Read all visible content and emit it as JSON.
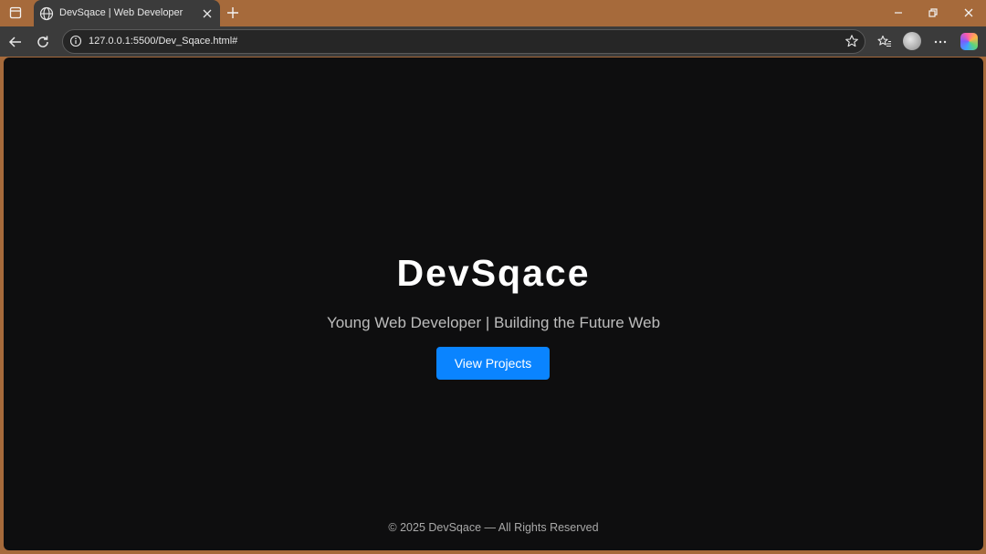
{
  "browser": {
    "tab_title": "DevSqace | Web Developer",
    "url": "127.0.0.1:5500/Dev_Sqace.html#",
    "icons": {
      "window": "window-icon",
      "tab": "globe-icon",
      "close": "close-icon",
      "new_tab": "plus-icon",
      "back": "back-arrow-icon",
      "reload": "reload-icon",
      "info": "info-icon",
      "bookmark": "star-icon",
      "favorites": "favorites-icon",
      "profile": "avatar",
      "menu": "more-icon",
      "copilot": "copilot-icon"
    }
  },
  "page": {
    "title": "DevSqace",
    "subtitle": "Young Web Developer | Building the Future Web",
    "cta_label": "View Projects",
    "footer": "© 2025 DevSqace — All Rights Reserved"
  },
  "colors": {
    "frame": "#a66a3b",
    "toolbar": "#3b3b3b",
    "page_bg": "#0e0e0f",
    "accent": "#0a84ff"
  }
}
